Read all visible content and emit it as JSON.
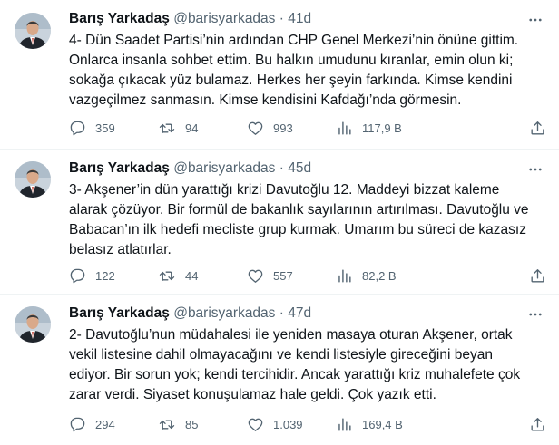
{
  "tweets": [
    {
      "name": "Barış Yarkadaş",
      "handle": "@barisyarkadas",
      "separator": "·",
      "age": "41d",
      "text": "4- Dün Saadet Partisi’nin ardından CHP Genel Merkezi’nin önüne gittim. Onlarca insanla sohbet ettim. Bu halkın umudunu kıranlar, emin olun ki; sokağa çıkacak yüz bulamaz. Herkes her şeyin farkında. Kimse kendini vazgeçilmez sanmasın. Kimse kendisini Kafdağı’nda görmesin.",
      "replies": "359",
      "retweets": "94",
      "likes": "993",
      "views": "117,9 B"
    },
    {
      "name": "Barış Yarkadaş",
      "handle": "@barisyarkadas",
      "separator": "·",
      "age": "45d",
      "text": "3- Akşener’in dün yarattığı krizi Davutoğlu 12. Maddeyi bizzat kaleme alarak çözüyor. Bir formül de bakanlık sayılarının artırılması. Davutoğlu ve Babacan’ın ilk hedefi mecliste grup kurmak. Umarım bu süreci de kazasız belasız atlatırlar.",
      "replies": "122",
      "retweets": "44",
      "likes": "557",
      "views": "82,2 B"
    },
    {
      "name": "Barış Yarkadaş",
      "handle": "@barisyarkadas",
      "separator": "·",
      "age": "47d",
      "text": "2- Davutoğlu’nun müdahalesi ile yeniden masaya oturan Akşener,  ortak vekil listesine dahil olmayacağını ve kendi listesiyle gireceğini beyan ediyor. Bir sorun yok; kendi tercihidir. Ancak yarattığı kriz muhalefete çok zarar verdi. Siyaset konuşulamaz hale geldi. Çok yazık etti.",
      "replies": "294",
      "retweets": "85",
      "likes": "1.039",
      "views": "169,4 B"
    }
  ],
  "icons": {
    "reply": "reply-icon",
    "retweet": "retweet-icon",
    "like": "like-icon",
    "views": "views-icon",
    "share": "share-icon",
    "more": "more-icon"
  },
  "colors": {
    "text": "#0f1419",
    "secondary": "#536471",
    "divider": "#eff3f4"
  }
}
